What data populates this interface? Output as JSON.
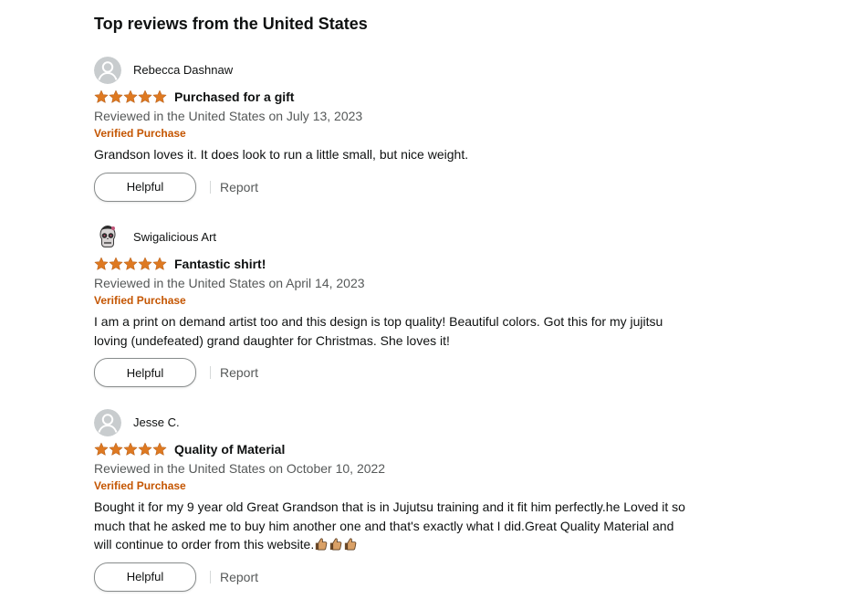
{
  "section_title": "Top reviews from the United States",
  "colors": {
    "star": "#de7921",
    "verified": "#c45500",
    "secondary_text": "#565959"
  },
  "reviews": [
    {
      "reviewer": "Rebecca Dashnaw",
      "avatar": "default-avatar-icon",
      "rating": 5,
      "title": "Purchased for a gift",
      "date": "Reviewed in the United States on July 13, 2023",
      "verified": "Verified Purchase",
      "body": "Grandson loves it. It does look to run a little small, but nice weight.",
      "helpful_label": "Helpful",
      "report_label": "Report"
    },
    {
      "reviewer": "Swigalicious Art",
      "avatar": "sugar-skull-avatar-icon",
      "rating": 5,
      "title": "Fantastic shirt!",
      "date": "Reviewed in the United States on April 14, 2023",
      "verified": "Verified Purchase",
      "body_lines": [
        "I am a print on demand artist too and this design is top quality! Beautiful colors. Got this for my jujitsu",
        "loving (undefeated) grand daughter for Christmas. She loves it!"
      ],
      "helpful_label": "Helpful",
      "report_label": "Report"
    },
    {
      "reviewer": "Jesse C.",
      "avatar": "default-avatar-icon",
      "rating": 5,
      "title": "Quality of Material",
      "date": "Reviewed in the United States on October 10, 2022",
      "verified": "Verified Purchase",
      "body_lines": [
        "Bought it for my 9 year old Great Grandson that is in Jujutsu training and it fit him perfectly.he Loved it so",
        "much that he asked me to buy him another one and that's exactly what I did.Great Quality Material and",
        "will continue to order from this website."
      ],
      "body_emoji": "thumbs-up-icon x3",
      "helpful_label": "Helpful",
      "report_label": "Report"
    }
  ]
}
